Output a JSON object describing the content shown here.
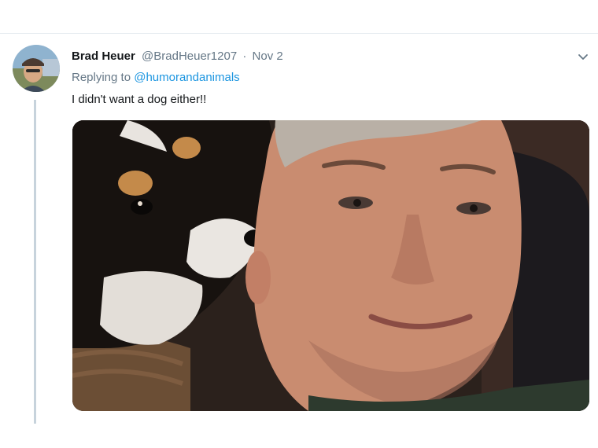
{
  "tweet": {
    "display_name": "Brad Heuer",
    "handle": "@BradHeuer1207",
    "separator": "·",
    "date": "Nov 2",
    "replying_prefix": "Replying to",
    "replying_to": "@humorandanimals",
    "text": "I didn't want a dog either!!"
  },
  "icons": {
    "menu": "chevron-down-icon"
  },
  "colors": {
    "link": "#1b95e0",
    "secondary_text": "#657786",
    "primary_text": "#14171a",
    "thread_line": "#c7d3dc"
  }
}
